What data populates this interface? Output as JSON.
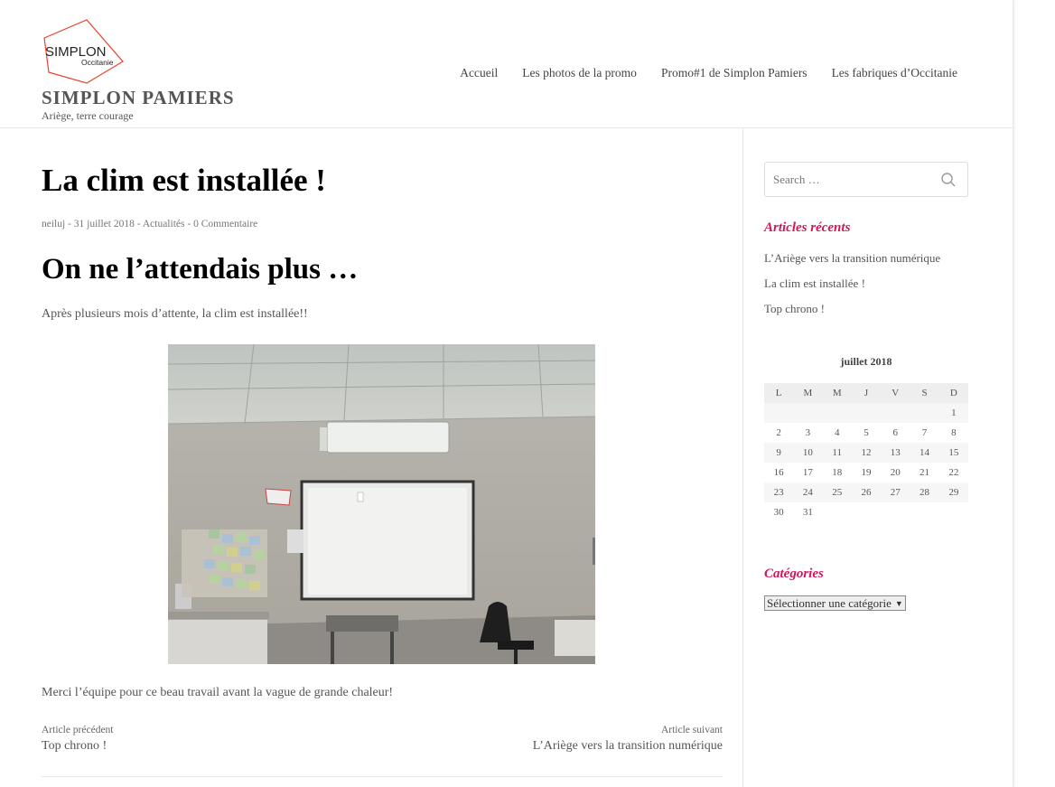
{
  "site": {
    "logo_text": "SIMPLON",
    "logo_sub": "Occitanie",
    "title": "SIMPLON PAMIERS",
    "description": "Ariège, terre courage"
  },
  "nav": {
    "items": [
      "Accueil",
      "Les photos de la promo",
      "Promo#1 de Simplon Pamiers",
      "Les fabriques d’Occitanie"
    ]
  },
  "post": {
    "title": "La clim est installée !",
    "meta": {
      "author": "neiluj",
      "sep": " - ",
      "date": "31 juillet 2018",
      "category": "Actualités",
      "comments": "0 Commentaire"
    },
    "heading": "On ne l’attendais plus …",
    "paragraph1": "Après plusieurs mois d’attente, la clim est installée!!",
    "paragraph2": "Merci l’équipe pour ce beau travail avant la vague de grande chaleur!"
  },
  "post_nav": {
    "prev_label": "Article précédent",
    "prev_title": "Top chrono !",
    "next_label": "Article suivant",
    "next_title": "L’Ariège vers la transition numérique"
  },
  "sidebar": {
    "search_placeholder": "Search …",
    "recent_title": "Articles récents",
    "recent": [
      "L’Ariège vers la transition numérique",
      "La clim est installée !",
      "Top chrono !"
    ],
    "calendar": {
      "caption": "juillet 2018",
      "days": [
        "L",
        "M",
        "M",
        "J",
        "V",
        "S",
        "D"
      ],
      "weeks": [
        [
          "",
          "",
          "",
          "",
          "",
          "",
          "1"
        ],
        [
          "2",
          "3",
          "4",
          "5",
          "6",
          "7",
          "8"
        ],
        [
          "9",
          "10",
          "11",
          "12",
          "13",
          "14",
          "15"
        ],
        [
          "16",
          "17",
          "18",
          "19",
          "20",
          "21",
          "22"
        ],
        [
          "23",
          "24",
          "25",
          "26",
          "27",
          "28",
          "29"
        ],
        [
          "30",
          "31",
          "",
          "",
          "",
          "",
          ""
        ]
      ]
    },
    "categories_title": "Catégories",
    "categories_select": "Sélectionner une catégorie"
  },
  "colors": {
    "accent": "#d4145a",
    "text": "#555555",
    "logo_red": "#e8442e"
  }
}
